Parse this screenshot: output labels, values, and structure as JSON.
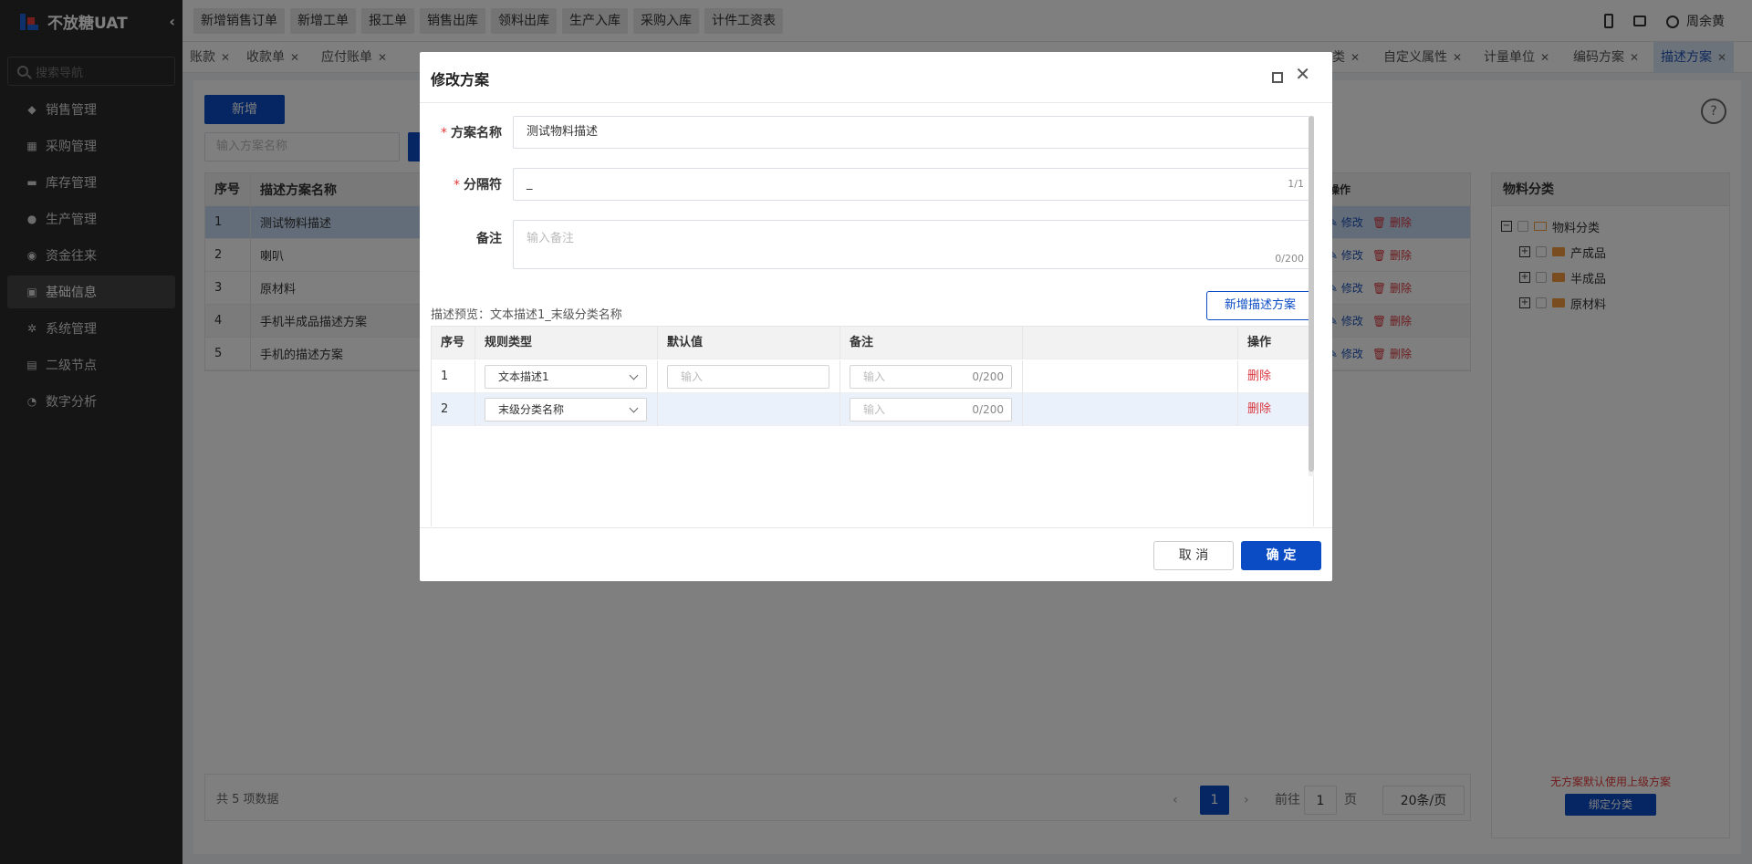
{
  "app": {
    "brand": "不放糖UAT"
  },
  "sidebar": {
    "search_placeholder": "搜索导航",
    "items": [
      {
        "label": "销售管理",
        "icon": "tag-icon"
      },
      {
        "label": "采购管理",
        "icon": "cart-icon"
      },
      {
        "label": "库存管理",
        "icon": "box-icon"
      },
      {
        "label": "生产管理",
        "icon": "factory-icon"
      },
      {
        "label": "资金往来",
        "icon": "money-icon"
      },
      {
        "label": "基础信息",
        "icon": "grid-icon"
      },
      {
        "label": "系统管理",
        "icon": "settings-icon"
      },
      {
        "label": "二级节点",
        "icon": "doc-icon"
      },
      {
        "label": "数字分析",
        "icon": "pie-icon"
      }
    ]
  },
  "topbar": {
    "quick": [
      "新增销售订单",
      "新增工单",
      "报工单",
      "销售出库",
      "领料出库",
      "生产入库",
      "采购入库",
      "计件工资表"
    ],
    "user": "周余黄"
  },
  "tabs": {
    "left": [
      "账款",
      "收款单",
      "应付账单"
    ],
    "right": [
      "类",
      "自定义属性",
      "计量单位",
      "编码方案",
      "描述方案"
    ]
  },
  "main": {
    "add_label": "新增",
    "search_placeholder": "输入方案名称",
    "columns": {
      "num": "序号",
      "name": "描述方案名称",
      "ops": "操作"
    },
    "rows": [
      {
        "num": "1",
        "name": "测试物料描述"
      },
      {
        "num": "2",
        "name": "喇叭"
      },
      {
        "num": "3",
        "name": "原材料"
      },
      {
        "num": "4",
        "name": "手机半成品描述方案"
      },
      {
        "num": "5",
        "name": "手机的描述方案"
      }
    ],
    "op_edit": "修改",
    "op_delete": "删除",
    "total": "共 5 项数据",
    "page": "1",
    "goto_label": "前往",
    "goto_value": "1",
    "page_suffix": "页",
    "page_size": "20条/页"
  },
  "right_panel": {
    "title": "物料分类",
    "root": "物料分类",
    "children": [
      "产成品",
      "半成品",
      "原材料"
    ],
    "hint": "无方案默认使用上级方案",
    "bind_label": "绑定分类"
  },
  "modal": {
    "title": "修改方案",
    "name_label": "方案名称",
    "name_value": "测试物料描述",
    "sep_label": "分隔符",
    "sep_value": "_",
    "sep_count": "1/1",
    "note_label": "备注",
    "note_placeholder": "输入备注",
    "note_count": "0/200",
    "preview": "描述预览：文本描述1_末级分类名称",
    "add_desc_label": "新增描述方案",
    "columns": {
      "num": "序号",
      "type": "规则类型",
      "default": "默认值",
      "note": "备注",
      "ops": "操作"
    },
    "rows": [
      {
        "num": "1",
        "type": "文本描述1",
        "default_placeholder": "输入",
        "note_placeholder": "输入",
        "note_count": "0/200",
        "delete": "删除"
      },
      {
        "num": "2",
        "type": "末级分类名称",
        "note_placeholder": "输入",
        "note_count": "0/200",
        "delete": "删除"
      }
    ],
    "cancel_label": "取 消",
    "ok_label": "确 定"
  },
  "colors": {
    "primary": "#0b4cc4",
    "danger": "#d9363e",
    "sidebar": "#2b2b2b"
  }
}
